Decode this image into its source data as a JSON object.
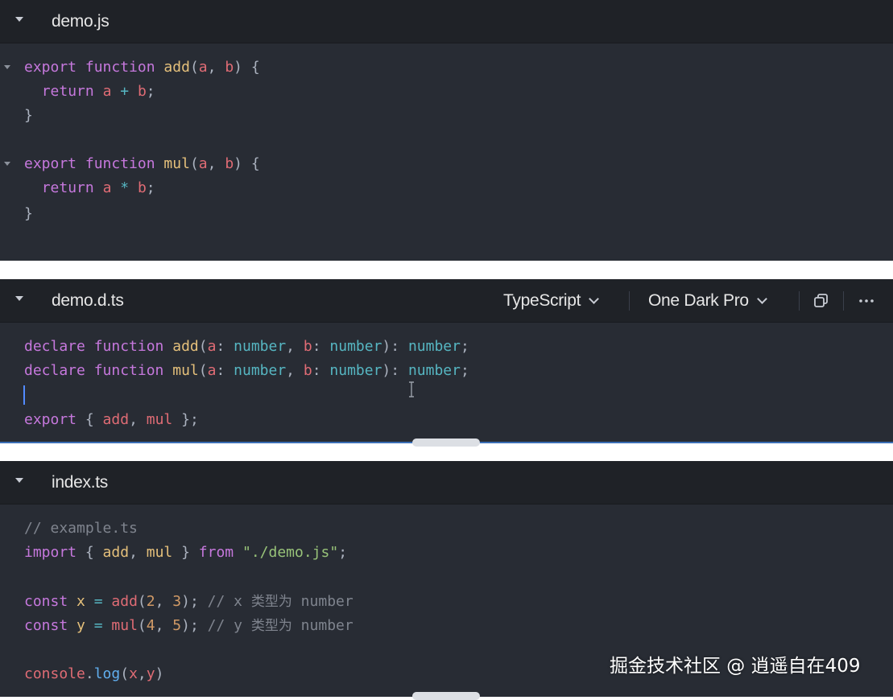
{
  "panels": [
    {
      "filename": "demo.js",
      "lines": [
        [
          [
            "export",
            "kw"
          ],
          [
            " ",
            "punc"
          ],
          [
            "function",
            "kw"
          ],
          [
            " ",
            "punc"
          ],
          [
            "add",
            "fn"
          ],
          [
            "(",
            "punc"
          ],
          [
            "a",
            "var"
          ],
          [
            ", ",
            "punc"
          ],
          [
            "b",
            "var"
          ],
          [
            ") {",
            "punc"
          ]
        ],
        [
          [
            "  ",
            "punc"
          ],
          [
            "return",
            "kw"
          ],
          [
            " ",
            "punc"
          ],
          [
            "a",
            "var"
          ],
          [
            " ",
            "punc"
          ],
          [
            "+",
            "op"
          ],
          [
            " ",
            "punc"
          ],
          [
            "b",
            "var"
          ],
          [
            ";",
            "punc"
          ]
        ],
        [
          [
            "}",
            "punc"
          ]
        ],
        [],
        [
          [
            "export",
            "kw"
          ],
          [
            " ",
            "punc"
          ],
          [
            "function",
            "kw"
          ],
          [
            " ",
            "punc"
          ],
          [
            "mul",
            "fn"
          ],
          [
            "(",
            "punc"
          ],
          [
            "a",
            "var"
          ],
          [
            ", ",
            "punc"
          ],
          [
            "b",
            "var"
          ],
          [
            ") {",
            "punc"
          ]
        ],
        [
          [
            "  ",
            "punc"
          ],
          [
            "return",
            "kw"
          ],
          [
            " ",
            "punc"
          ],
          [
            "a",
            "var"
          ],
          [
            " ",
            "punc"
          ],
          [
            "*",
            "op"
          ],
          [
            " ",
            "punc"
          ],
          [
            "b",
            "var"
          ],
          [
            ";",
            "punc"
          ]
        ],
        [
          [
            "}",
            "punc"
          ]
        ]
      ]
    },
    {
      "filename": "demo.d.ts",
      "language_select": "TypeScript",
      "theme_select": "One Dark Pro",
      "lines": [
        [
          [
            "declare",
            "kw"
          ],
          [
            " ",
            "punc"
          ],
          [
            "function",
            "kw"
          ],
          [
            " ",
            "punc"
          ],
          [
            "add",
            "fn"
          ],
          [
            "(",
            "punc"
          ],
          [
            "a",
            "var"
          ],
          [
            ": ",
            "punc"
          ],
          [
            "number",
            "type"
          ],
          [
            ", ",
            "punc"
          ],
          [
            "b",
            "var"
          ],
          [
            ": ",
            "punc"
          ],
          [
            "number",
            "type"
          ],
          [
            "): ",
            "punc"
          ],
          [
            "number",
            "type"
          ],
          [
            ";",
            "punc"
          ]
        ],
        [
          [
            "declare",
            "kw"
          ],
          [
            " ",
            "punc"
          ],
          [
            "function",
            "kw"
          ],
          [
            " ",
            "punc"
          ],
          [
            "mul",
            "fn"
          ],
          [
            "(",
            "punc"
          ],
          [
            "a",
            "var"
          ],
          [
            ": ",
            "punc"
          ],
          [
            "number",
            "type"
          ],
          [
            ", ",
            "punc"
          ],
          [
            "b",
            "var"
          ],
          [
            ": ",
            "punc"
          ],
          [
            "number",
            "type"
          ],
          [
            "): ",
            "punc"
          ],
          [
            "number",
            "type"
          ],
          [
            ";",
            "punc"
          ]
        ],
        [],
        [
          [
            "export",
            "kw"
          ],
          [
            " { ",
            "punc"
          ],
          [
            "add",
            "var"
          ],
          [
            ", ",
            "punc"
          ],
          [
            "mul",
            "var"
          ],
          [
            " };",
            "punc"
          ]
        ]
      ]
    },
    {
      "filename": "index.ts",
      "lines": [
        [
          [
            "// example.ts",
            "cm"
          ]
        ],
        [
          [
            "import",
            "kw"
          ],
          [
            " { ",
            "punc"
          ],
          [
            "add",
            "fn"
          ],
          [
            ", ",
            "punc"
          ],
          [
            "mul",
            "fn"
          ],
          [
            " } ",
            "punc"
          ],
          [
            "from",
            "kw"
          ],
          [
            " ",
            "punc"
          ],
          [
            "\"./demo.js\"",
            "str"
          ],
          [
            ";",
            "punc"
          ]
        ],
        [],
        [
          [
            "const",
            "kw"
          ],
          [
            " ",
            "punc"
          ],
          [
            "x",
            "fn"
          ],
          [
            " ",
            "punc"
          ],
          [
            "=",
            "op"
          ],
          [
            " ",
            "punc"
          ],
          [
            "add",
            "var"
          ],
          [
            "(",
            "punc"
          ],
          [
            "2",
            "num"
          ],
          [
            ", ",
            "punc"
          ],
          [
            "3",
            "num"
          ],
          [
            "); ",
            "punc"
          ],
          [
            "// x ",
            "cm"
          ],
          [
            "类型为",
            "cmcjk"
          ],
          [
            " number",
            "cm"
          ]
        ],
        [
          [
            "const",
            "kw"
          ],
          [
            " ",
            "punc"
          ],
          [
            "y",
            "fn"
          ],
          [
            " ",
            "punc"
          ],
          [
            "=",
            "op"
          ],
          [
            " ",
            "punc"
          ],
          [
            "mul",
            "var"
          ],
          [
            "(",
            "punc"
          ],
          [
            "4",
            "num"
          ],
          [
            ", ",
            "punc"
          ],
          [
            "5",
            "num"
          ],
          [
            "); ",
            "punc"
          ],
          [
            "// y ",
            "cm"
          ],
          [
            "类型为",
            "cmcjk"
          ],
          [
            " number",
            "cm"
          ]
        ],
        [],
        [
          [
            "console",
            "var"
          ],
          [
            ".",
            "punc"
          ],
          [
            "log",
            "fnb"
          ],
          [
            "(",
            "punc"
          ],
          [
            "x",
            "var"
          ],
          [
            ",",
            "punc"
          ],
          [
            "y",
            "var"
          ],
          [
            ")",
            "punc"
          ]
        ]
      ]
    }
  ],
  "watermark": "掘金技术社区 @ 逍遥自在409",
  "icons": {
    "collapse": "caret-down-icon",
    "fold": "fold-caret-icon",
    "copy": "copy-icon",
    "more": "more-horizontal-icon",
    "select": "chevron-down-icon"
  },
  "colors": {
    "keyword": "#c678dd",
    "function": "#e5c07b",
    "variable": "#e06c75",
    "type": "#56b6c2",
    "number": "#d19a66",
    "string": "#98c379",
    "comment": "#7f848e",
    "editor_bg": "#282c34",
    "header_bg": "#1f2227"
  }
}
